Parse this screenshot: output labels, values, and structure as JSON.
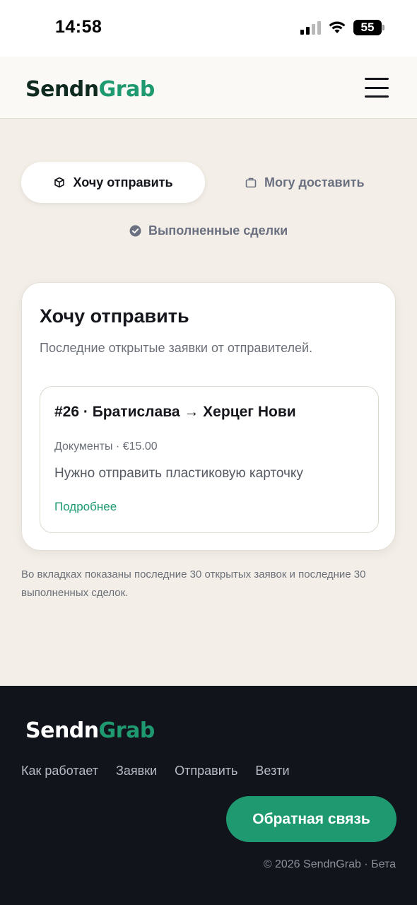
{
  "status_bar": {
    "time": "14:58",
    "battery": "55"
  },
  "header": {
    "logo_part1": "Sendn",
    "logo_part2": "Grab"
  },
  "tabs": [
    {
      "label": "Хочу отправить",
      "icon": "box-icon",
      "active": true
    },
    {
      "label": "Могу доставить",
      "icon": "bag-icon",
      "active": false
    },
    {
      "label": "Выполненные сделки",
      "icon": "check-circle-icon",
      "active": false
    }
  ],
  "card": {
    "title": "Хочу отправить",
    "subtitle": "Последние открытые заявки от отправителей.",
    "order": {
      "title": "#26 · Братислава → Херцег Нови",
      "meta": "Документы · €15.00",
      "description": "Нужно отправить пластиковую карточку",
      "link": "Подробнее"
    }
  },
  "note": "Во вкладках показаны последние 30 открытых заявок и последние 30 выполненных сделок.",
  "footer": {
    "logo_part1": "Sendn",
    "logo_part2": "Grab",
    "nav": [
      "Как работает",
      "Заявки",
      "Отправить",
      "Везти"
    ],
    "feedback_button": "Обратная связь",
    "copyright": "© 2026 SendnGrab · Бета"
  },
  "colors": {
    "accent": "#1f9a70",
    "background": "#f3efe8",
    "footer": "#12141b"
  }
}
